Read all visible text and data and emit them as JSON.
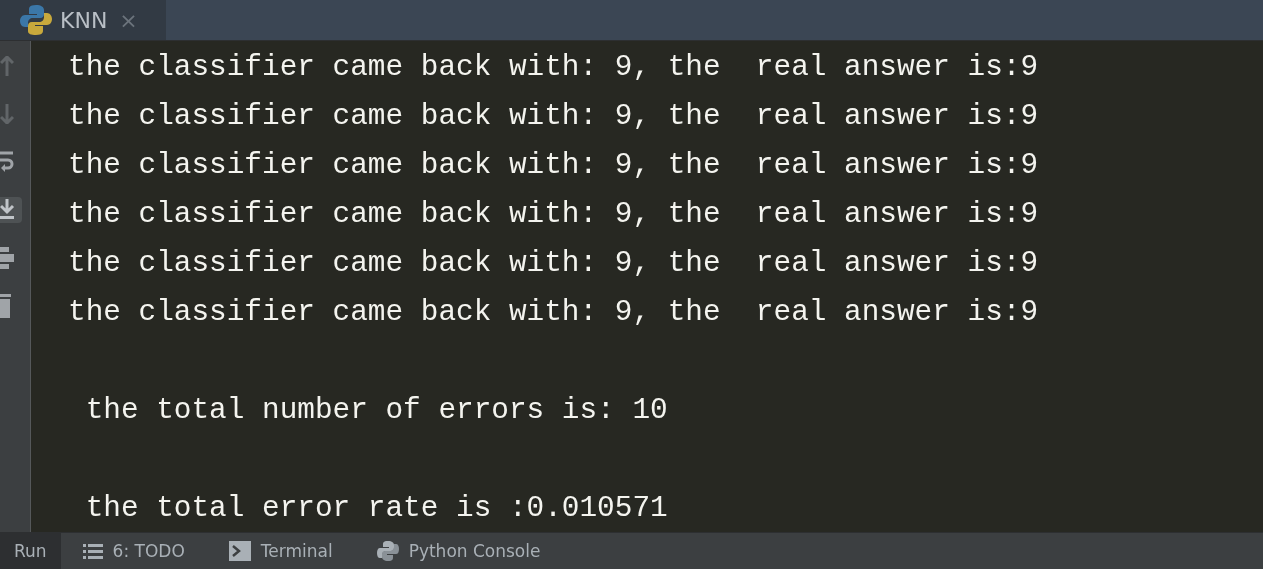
{
  "editor_tab": {
    "label": "KNN",
    "close": "×",
    "selected": true
  },
  "console_blocks": [
    [
      "the classifier came back with: 9, the  real answer is:9",
      "the classifier came back with: 9, the  real answer is:9",
      "the classifier came back with: 9, the  real answer is:9",
      "the classifier came back with: 9, the  real answer is:9",
      "the classifier came back with: 9, the  real answer is:9",
      "the classifier came back with: 9, the  real answer is:9"
    ],
    [
      " the total number of errors is: 10"
    ],
    [
      " the total error rate is :0.010571"
    ]
  ],
  "tool_windows": [
    {
      "label": "Run",
      "selected": true,
      "kind": "plain"
    },
    {
      "label": "6: TODO",
      "selected": false,
      "kind": "list"
    },
    {
      "label": "Terminal",
      "selected": false,
      "kind": "terminal"
    },
    {
      "label": "Python Console",
      "selected": false,
      "kind": "python"
    }
  ]
}
